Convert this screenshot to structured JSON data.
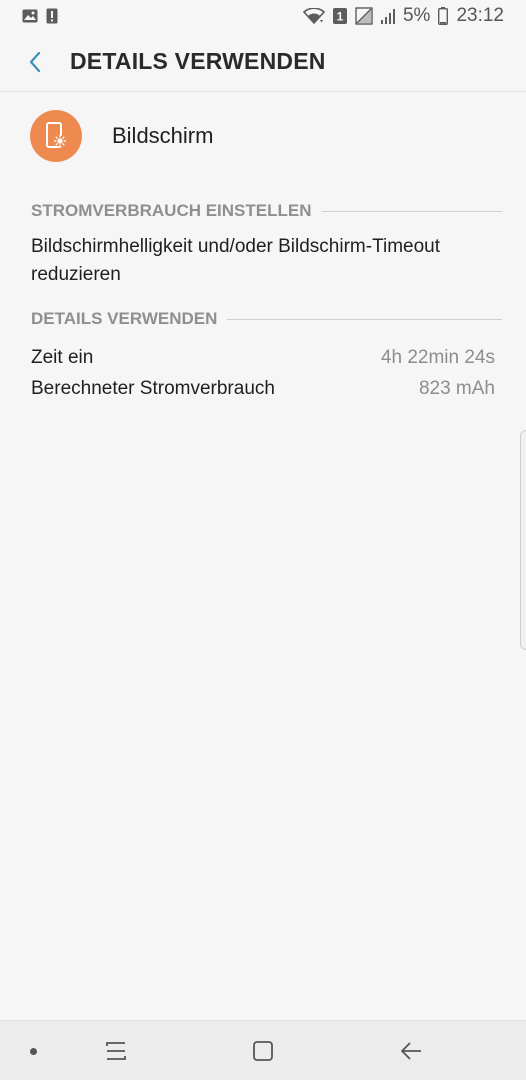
{
  "status_bar": {
    "battery_percent": "5%",
    "time": "23:12",
    "sim_badge": "1",
    "icons": [
      "image-notification-icon",
      "alert-notification-icon",
      "wifi-icon",
      "sim-badge",
      "no-sim-icon",
      "signal-icon",
      "battery-icon"
    ]
  },
  "header": {
    "title": "DETAILS VERWENDEN",
    "back_icon": "back-chevron-icon"
  },
  "item": {
    "title": "Bildschirm",
    "icon": "screen-brightness-icon",
    "icon_color": "#ee8a4f"
  },
  "section_power": {
    "header": "STROMVERBRAUCH EINSTELLEN",
    "description": "Bildschirmhelligkeit und/oder Bildschirm-Timeout reduzieren"
  },
  "section_details": {
    "header": "DETAILS VERWENDEN",
    "rows": [
      {
        "label": "Zeit ein",
        "value": "4h 22min 24s"
      },
      {
        "label": "Berechneter Stromverbrauch",
        "value": "823 mAh"
      }
    ]
  },
  "nav_bar": {
    "buttons": [
      "recent-apps-icon",
      "home-icon",
      "back-arrow-icon"
    ]
  },
  "colors": {
    "accent": "#3a8fb5",
    "background": "#f6f6f6",
    "section_header": "#8f8f8f"
  }
}
